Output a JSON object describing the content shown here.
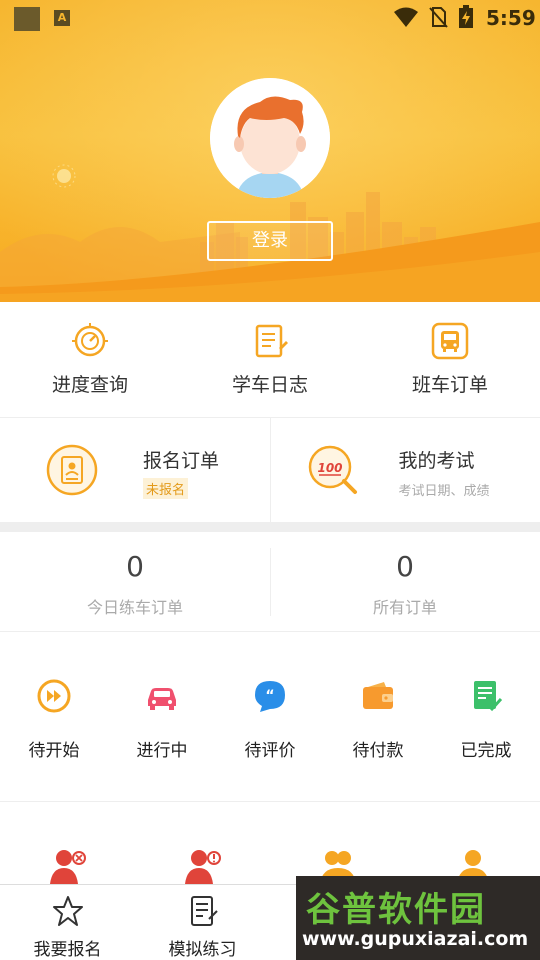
{
  "status_bar": {
    "notification_icon": "a-icon",
    "notification_letter": "A",
    "time": "5:59"
  },
  "profile": {
    "login_label": "登录"
  },
  "quick_menu": [
    {
      "label": "进度查询",
      "icon": "progress-icon"
    },
    {
      "label": "学车日志",
      "icon": "notebook-icon"
    },
    {
      "label": "班车订单",
      "icon": "bus-icon"
    }
  ],
  "orders": {
    "signup": {
      "title": "报名订单",
      "badge": "未报名"
    },
    "exam": {
      "title": "我的考试",
      "subtitle": "考试日期、成绩"
    }
  },
  "counts": [
    {
      "value": "0",
      "label": "今日练车订单"
    },
    {
      "value": "0",
      "label": "所有订单"
    }
  ],
  "status_tabs": [
    {
      "label": "待开始",
      "icon": "play-icon",
      "color": "#f5a623"
    },
    {
      "label": "进行中",
      "icon": "car-icon",
      "color": "#f0506e"
    },
    {
      "label": "待评价",
      "icon": "chat-icon",
      "color": "#2a8ee8"
    },
    {
      "label": "待付款",
      "icon": "wallet-icon",
      "color": "#f79a2e"
    },
    {
      "label": "已完成",
      "icon": "done-doc-icon",
      "color": "#3cc06a"
    }
  ],
  "bottom_nav": [
    {
      "label": "我要报名",
      "icon": "star-icon"
    },
    {
      "label": "模拟练习",
      "icon": "exam-doc-icon"
    }
  ],
  "watermark": {
    "title": "谷普软件园",
    "url": "www.gupuxiazai.com"
  },
  "colors": {
    "header": "#f6b52e",
    "accent": "#f5a623"
  }
}
